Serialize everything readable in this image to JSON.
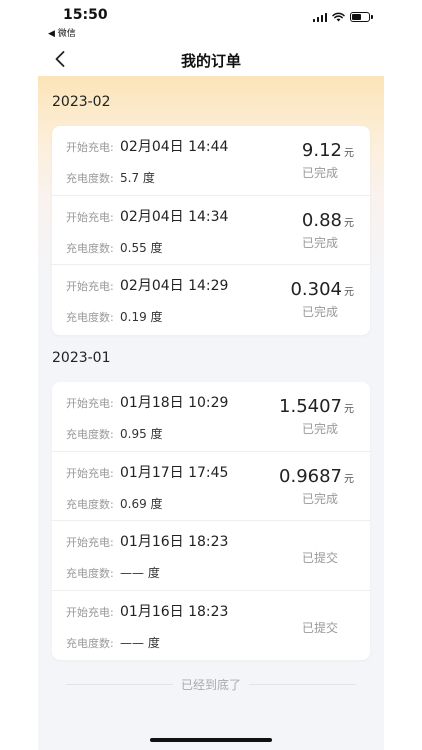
{
  "status_bar": {
    "time": "15:50",
    "back_app": "◀ 微信"
  },
  "header": {
    "title": "我的订单"
  },
  "labels": {
    "start_charge": "开始充电:",
    "kwh": "充电度数:",
    "unit_kwh": "度",
    "unit_yuan": "元"
  },
  "groups": [
    {
      "month": "2023-02",
      "orders": [
        {
          "time": "02月04日 14:44",
          "kwh": "5.7",
          "amount": "9.12",
          "status": "已完成"
        },
        {
          "time": "02月04日 14:34",
          "kwh": "0.55",
          "amount": "0.88",
          "status": "已完成"
        },
        {
          "time": "02月04日 14:29",
          "kwh": "0.19",
          "amount": "0.304",
          "status": "已完成"
        }
      ]
    },
    {
      "month": "2023-01",
      "orders": [
        {
          "time": "01月18日 10:29",
          "kwh": "0.95",
          "amount": "1.5407",
          "status": "已完成"
        },
        {
          "time": "01月17日 17:45",
          "kwh": "0.69",
          "amount": "0.9687",
          "status": "已完成"
        },
        {
          "time": "01月16日 18:23",
          "kwh": "——",
          "amount": "",
          "status": "已提交"
        },
        {
          "time": "01月16日 18:23",
          "kwh": "——",
          "amount": "",
          "status": "已提交"
        }
      ]
    }
  ],
  "footer": {
    "text": "已经到底了"
  }
}
